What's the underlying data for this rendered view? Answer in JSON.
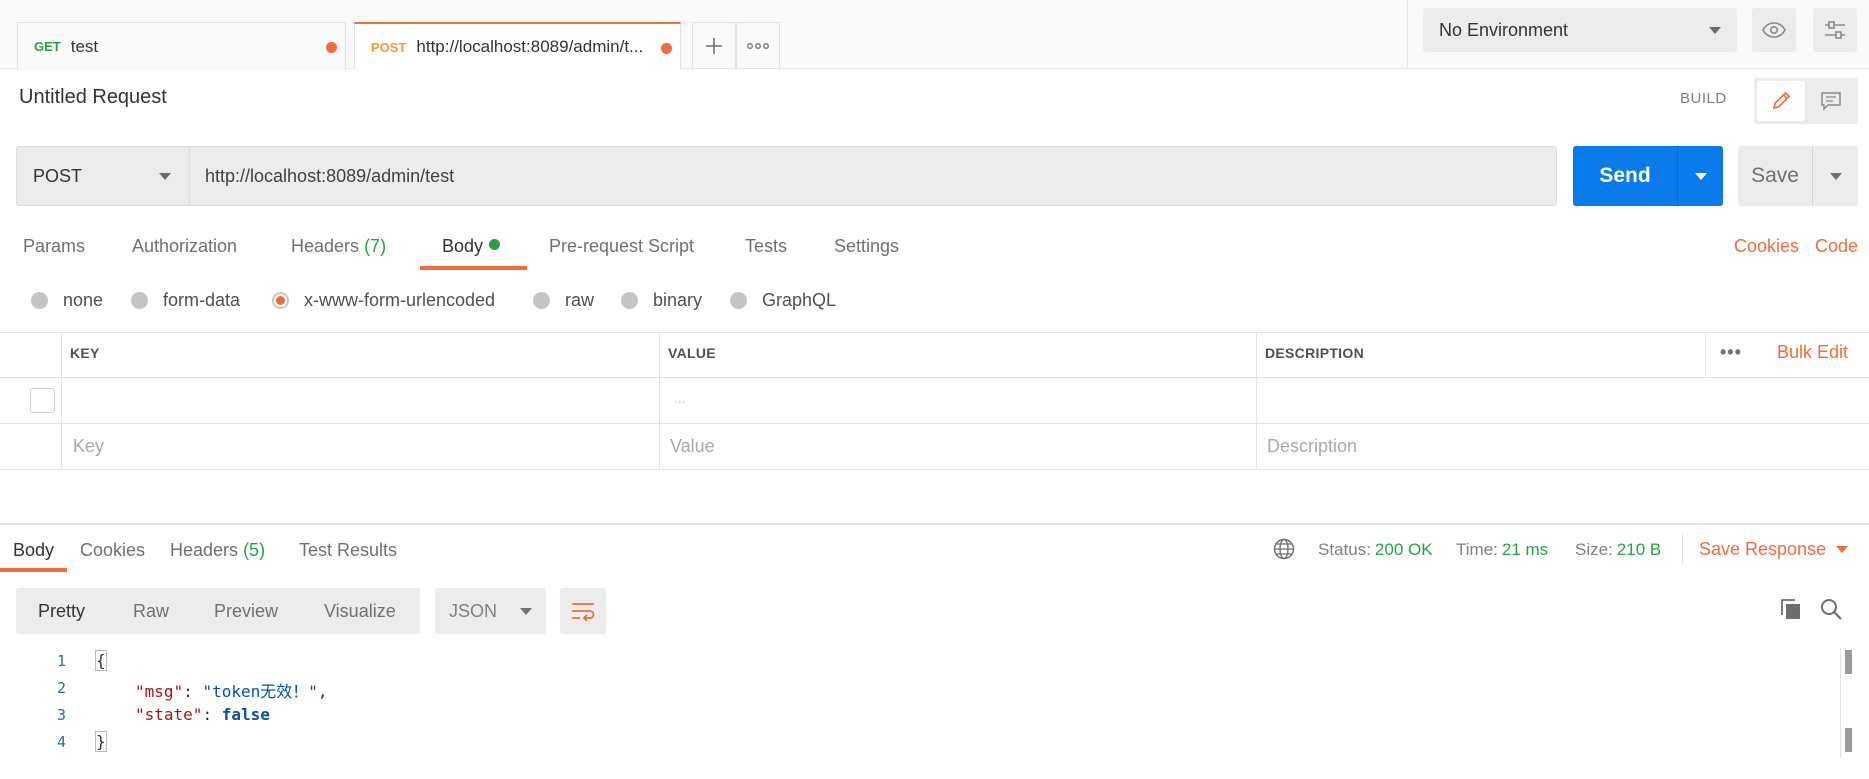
{
  "tabs": [
    {
      "method": "GET",
      "title": "test",
      "method_color": "#26a146"
    },
    {
      "method": "POST",
      "title": "http://localhost:8089/admin/t...",
      "method_color": "#f29a2e"
    }
  ],
  "environment": {
    "selected": "No Environment"
  },
  "request": {
    "title": "Untitled Request",
    "build_label": "BUILD",
    "method": "POST",
    "url": "http://localhost:8089/admin/test",
    "send_label": "Send",
    "save_label": "Save"
  },
  "request_tabs": {
    "params": "Params",
    "authorization": "Authorization",
    "headers": "Headers",
    "headers_count": "(7)",
    "body": "Body",
    "prerequest": "Pre-request Script",
    "tests": "Tests",
    "settings": "Settings",
    "cookies": "Cookies",
    "code": "Code"
  },
  "body_types": [
    "none",
    "form-data",
    "x-www-form-urlencoded",
    "raw",
    "binary",
    "GraphQL"
  ],
  "body_type_selected": "x-www-form-urlencoded",
  "kv_table": {
    "key_header": "KEY",
    "value_header": "VALUE",
    "description_header": "DESCRIPTION",
    "more": "•••",
    "bulk_edit": "Bulk Edit",
    "ellipsis": "...",
    "key_placeholder": "Key",
    "value_placeholder": "Value",
    "description_placeholder": "Description"
  },
  "response": {
    "tabs": {
      "body": "Body",
      "cookies": "Cookies",
      "headers": "Headers",
      "headers_count": "(5)",
      "test_results": "Test Results"
    },
    "status_label": "Status:",
    "status_value": "200 OK",
    "time_label": "Time:",
    "time_value": "21 ms",
    "size_label": "Size:",
    "size_value": "210 B",
    "save_response": "Save Response",
    "views": [
      "Pretty",
      "Raw",
      "Preview",
      "Visualize"
    ],
    "format": "JSON",
    "code": {
      "line_numbers": [
        "1",
        "2",
        "3",
        "4"
      ],
      "open_brace": "{",
      "msg_key": "\"msg\"",
      "msg_value": "\"token无效！\"",
      "state_key": "\"state\"",
      "state_value": "false",
      "close_brace": "}",
      "colon": ": ",
      "comma": ","
    }
  },
  "colors": {
    "accent": "#f26b3a",
    "send": "#097bed",
    "success": "#26a146"
  }
}
